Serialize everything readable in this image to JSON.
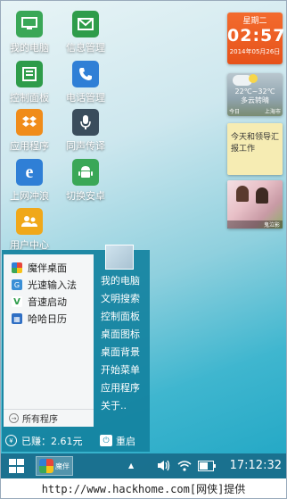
{
  "desktop_icons": [
    {
      "label": "我的电脑",
      "icon": "monitor-icon",
      "color": "#3aa757"
    },
    {
      "label": "信息管理",
      "icon": "message-icon",
      "color": "#2e9c4a"
    },
    {
      "label": "控制面板",
      "icon": "control-panel-icon",
      "color": "#2e9c4a"
    },
    {
      "label": "电话管理",
      "icon": "phone-icon",
      "color": "#2f7fd6"
    },
    {
      "label": "应用程序",
      "icon": "dropbox-icon",
      "color": "#f08c1a"
    },
    {
      "label": "同声传译",
      "icon": "microphone-icon",
      "color": "#3a4d5c"
    },
    {
      "label": "上网冲浪",
      "icon": "ie-browser-icon",
      "color": "#2f7fd6"
    },
    {
      "label": "切换安卓",
      "icon": "android-icon",
      "color": "#3aa757"
    },
    {
      "label": "用户中心",
      "icon": "users-icon",
      "color": "#f0a81a"
    }
  ],
  "clock_widget": {
    "weekday": "星期二",
    "time": "02:57",
    "date": "2014年05月26日"
  },
  "weather_widget": {
    "temperature": "22℃~32℃",
    "description": "多云转晴",
    "day": "今日",
    "city": "上海市"
  },
  "note_widget": {
    "text": "今天和领导汇报工作"
  },
  "photo_widget": {
    "caption": "鬼泣影"
  },
  "start_menu": {
    "recent_items": [
      {
        "label": "魔伴桌面",
        "icon": "pinwheel-icon",
        "color": "#e8463a"
      },
      {
        "label": "光速输入法",
        "icon": "keyboard-g-icon",
        "color": "#3a8fd6"
      },
      {
        "label": "音速启动",
        "icon": "v-launcher-icon",
        "color": "#2e9c4a"
      },
      {
        "label": "哈哈日历",
        "icon": "calendar-icon",
        "color": "#2f6fc4"
      }
    ],
    "all_programs": "所有程序",
    "right_items": [
      "我的电脑",
      "文明搜索",
      "控制面板",
      "桌面图标",
      "桌面背景",
      "开始菜单",
      "应用程序",
      "关于.."
    ],
    "earned": "已赚：2.61元",
    "restart": "重启"
  },
  "taskbar": {
    "app_label": "魔伴",
    "tray_up": "▲",
    "time": "17:12:32"
  },
  "credit": "http://www.hackhome.com[网侠]提供"
}
